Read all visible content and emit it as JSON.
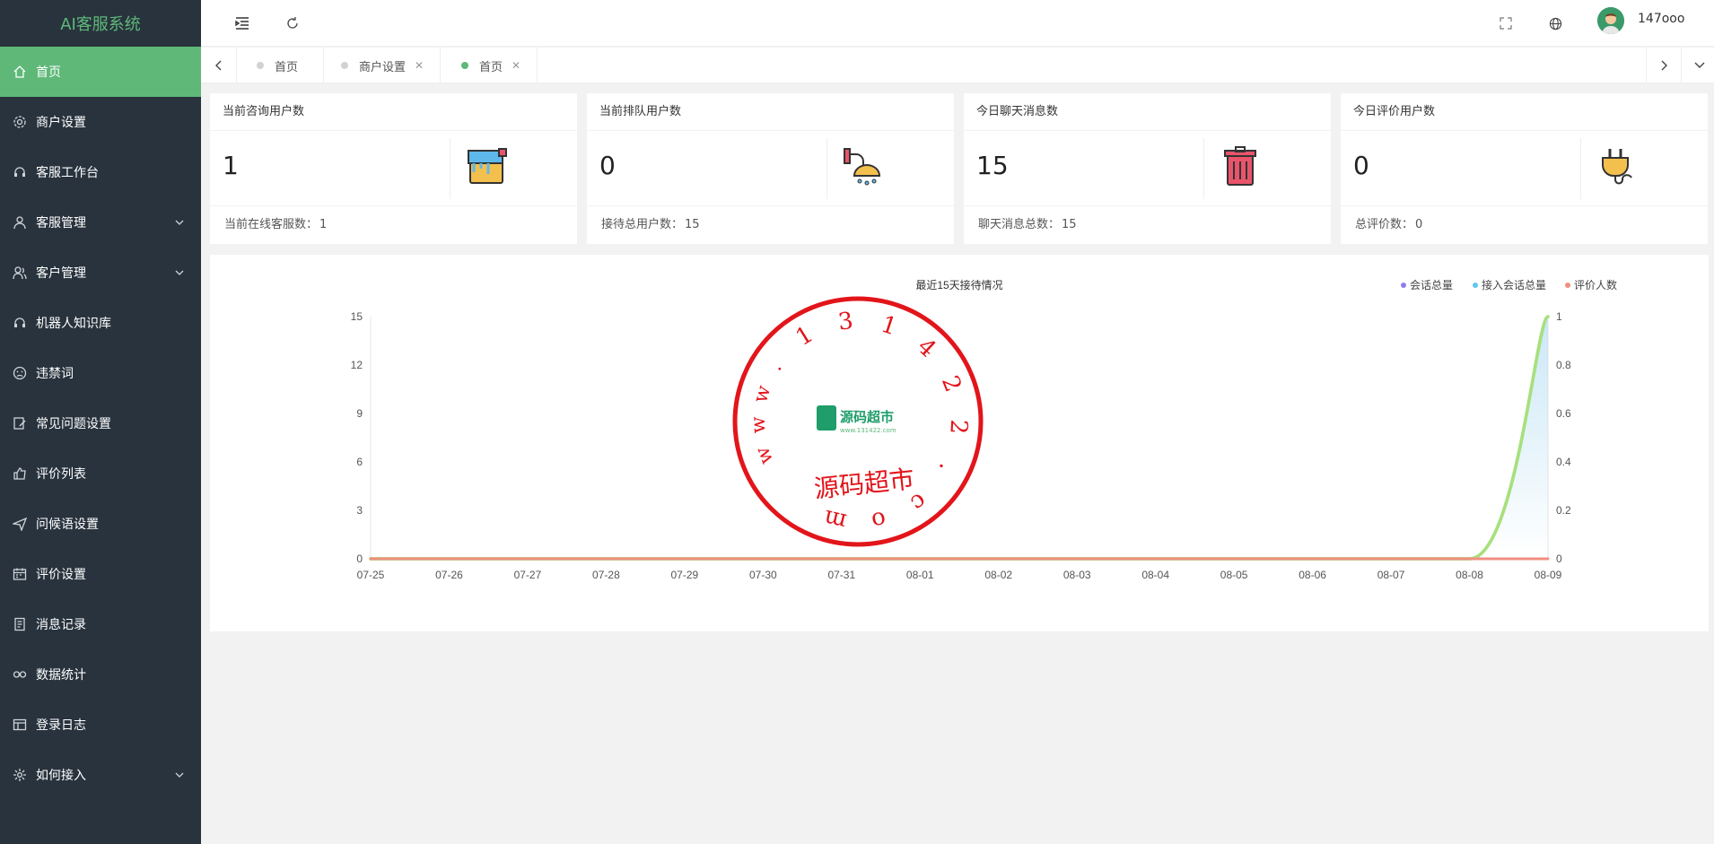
{
  "app": {
    "title": "AI客服系统"
  },
  "sidebar": {
    "items": [
      {
        "label": "首页",
        "icon": "home-icon",
        "active": true
      },
      {
        "label": "商户设置",
        "icon": "gear-icon"
      },
      {
        "label": "客服工作台",
        "icon": "headset-icon"
      },
      {
        "label": "客服管理",
        "icon": "user-icon",
        "expandable": true
      },
      {
        "label": "客户管理",
        "icon": "users-icon",
        "expandable": true
      },
      {
        "label": "机器人知识库",
        "icon": "headset-icon"
      },
      {
        "label": "违禁词",
        "icon": "face-icon"
      },
      {
        "label": "常见问题设置",
        "icon": "edit-icon"
      },
      {
        "label": "评价列表",
        "icon": "thumb-icon"
      },
      {
        "label": "问候语设置",
        "icon": "send-icon"
      },
      {
        "label": "评价设置",
        "icon": "calendar-icon"
      },
      {
        "label": "消息记录",
        "icon": "note-icon"
      },
      {
        "label": "数据统计",
        "icon": "link-icon"
      },
      {
        "label": "登录日志",
        "icon": "table-icon"
      },
      {
        "label": "如何接入",
        "icon": "cog-icon",
        "expandable": true
      }
    ]
  },
  "header": {
    "username": "147ooo"
  },
  "tabs": [
    {
      "label": "首页",
      "closable": false,
      "active": false
    },
    {
      "label": "商户设置",
      "closable": true,
      "active": false
    },
    {
      "label": "首页",
      "closable": true,
      "active": true
    }
  ],
  "cards": [
    {
      "title": "当前咨询用户数",
      "value": "1",
      "footer_label": "当前在线客服数：",
      "footer_value": "1",
      "icon": "paint-bucket-icon"
    },
    {
      "title": "当前排队用户数",
      "value": "0",
      "footer_label": "接待总用户数：",
      "footer_value": "15",
      "icon": "shower-icon"
    },
    {
      "title": "今日聊天消息数",
      "value": "15",
      "footer_label": "聊天消息总数：",
      "footer_value": "15",
      "icon": "trash-can-icon"
    },
    {
      "title": "今日评价用户数",
      "value": "0",
      "footer_label": "总评价数：",
      "footer_value": "0",
      "icon": "plug-icon"
    }
  ],
  "watermark": {
    "ring_text": "1 3 1 4 2 2 . c o m",
    "side_text": "w w w .",
    "bottom_text": "源码超市",
    "logo_text": "源码超市",
    "logo_sub": "www.131422.com"
  },
  "chart_data": {
    "type": "line",
    "title": "最近15天接待情况",
    "legend_position": "top-right",
    "x": [
      "07-25",
      "07-26",
      "07-27",
      "07-28",
      "07-29",
      "07-30",
      "07-31",
      "08-01",
      "08-02",
      "08-03",
      "08-04",
      "08-05",
      "08-06",
      "08-07",
      "08-08",
      "08-09"
    ],
    "y_left": {
      "ylim": [
        0,
        15
      ],
      "ticks": [
        "0",
        "3",
        "6",
        "9",
        "12",
        "15"
      ]
    },
    "y_right": {
      "ylim": [
        0,
        1
      ],
      "ticks": [
        "0",
        "0.2",
        "0.4",
        "0.6",
        "0.8",
        "1"
      ]
    },
    "series": [
      {
        "name": "会话总量",
        "color": "#8e7cf0",
        "axis": "left",
        "values": [
          0,
          0,
          0,
          0,
          0,
          0,
          0,
          0,
          0,
          0,
          0,
          0,
          0,
          0,
          0,
          15
        ]
      },
      {
        "name": "接入会话总量",
        "color": "#5fc6ef",
        "axis": "left",
        "values": [
          0,
          0,
          0,
          0,
          0,
          0,
          0,
          0,
          0,
          0,
          0,
          0,
          0,
          0,
          0,
          15
        ]
      },
      {
        "name": "评价人数",
        "color": "#f08f80",
        "axis": "right",
        "values": [
          0,
          0,
          0,
          0,
          0,
          0,
          0,
          0,
          0,
          0,
          0,
          0,
          0,
          0,
          0,
          0
        ]
      }
    ],
    "grid": false
  }
}
